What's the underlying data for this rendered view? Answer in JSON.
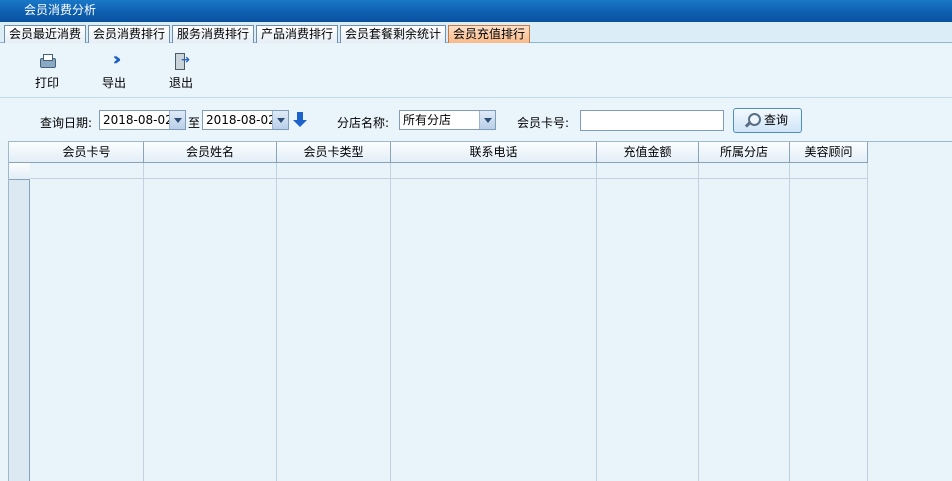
{
  "window": {
    "title": "会员消费分析"
  },
  "tabs": [
    {
      "label": "会员最近消费",
      "active": false
    },
    {
      "label": "会员消费排行",
      "active": false
    },
    {
      "label": "服务消费排行",
      "active": false
    },
    {
      "label": "产品消费排行",
      "active": false
    },
    {
      "label": "会员套餐剩余统计",
      "active": false
    },
    {
      "label": "会员充值排行",
      "active": true
    }
  ],
  "toolbar": {
    "print_label": "打印",
    "export_label": "导出",
    "exit_label": "退出"
  },
  "filter": {
    "date_label": "查询日期:",
    "date_from": "2018-08-02",
    "to_label": "至",
    "date_to": "2018-08-02",
    "store_label": "分店名称:",
    "store_value": "所有分店",
    "card_label": "会员卡号:",
    "card_value": "",
    "search_label": "查询"
  },
  "table": {
    "columns": [
      "会员卡号",
      "会员姓名",
      "会员卡类型",
      "联系电话",
      "充值金额",
      "所属分店",
      "美容顾问"
    ],
    "rows": []
  }
}
